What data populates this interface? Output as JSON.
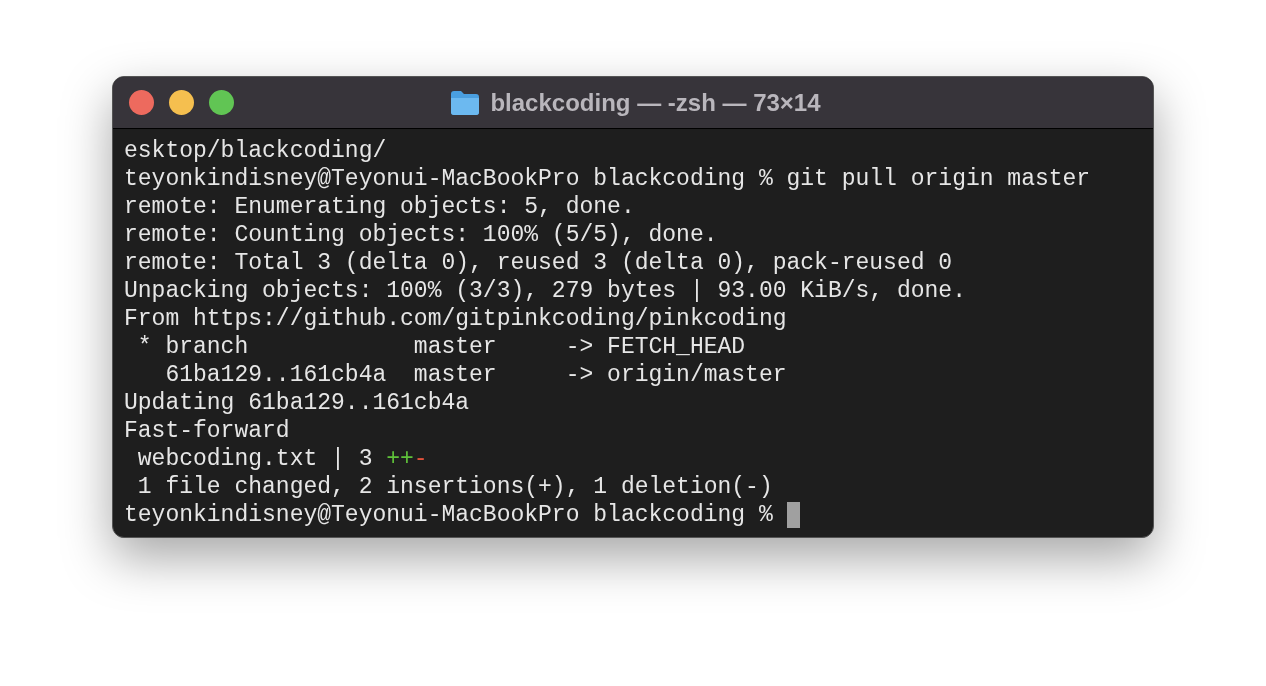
{
  "window": {
    "title": "blackcoding — -zsh — 73×14"
  },
  "terminal": {
    "lines": [
      [
        {
          "text": "esktop/blackcoding/",
          "kind": "plain"
        }
      ],
      [
        {
          "text": "teyonkindisney@Teyonui-MacBookPro blackcoding % git pull origin master",
          "kind": "plain"
        }
      ],
      [
        {
          "text": "remote: Enumerating objects: 5, done.",
          "kind": "plain"
        }
      ],
      [
        {
          "text": "remote: Counting objects: 100% (5/5), done.",
          "kind": "plain"
        }
      ],
      [
        {
          "text": "remote: Total 3 (delta 0), reused 3 (delta 0), pack-reused 0",
          "kind": "plain"
        }
      ],
      [
        {
          "text": "Unpacking objects: 100% (3/3), 279 bytes | 93.00 KiB/s, done.",
          "kind": "plain"
        }
      ],
      [
        {
          "text": "From https://github.com/gitpinkcoding/pinkcoding",
          "kind": "plain"
        }
      ],
      [
        {
          "text": " * branch            master     -> FETCH_HEAD",
          "kind": "plain"
        }
      ],
      [
        {
          "text": "   61ba129..161cb4a  master     -> origin/master",
          "kind": "plain"
        }
      ],
      [
        {
          "text": "Updating 61ba129..161cb4a",
          "kind": "plain"
        }
      ],
      [
        {
          "text": "Fast-forward",
          "kind": "plain"
        }
      ],
      [
        {
          "text": " webcoding.txt | 3 ",
          "kind": "plain"
        },
        {
          "text": "++",
          "kind": "added"
        },
        {
          "text": "-",
          "kind": "removed"
        }
      ],
      [
        {
          "text": " 1 file changed, 2 insertions(+), 1 deletion(-)",
          "kind": "plain"
        }
      ],
      [
        {
          "text": "teyonkindisney@Teyonui-MacBookPro blackcoding % ",
          "kind": "plain"
        }
      ]
    ],
    "cursor": true
  }
}
